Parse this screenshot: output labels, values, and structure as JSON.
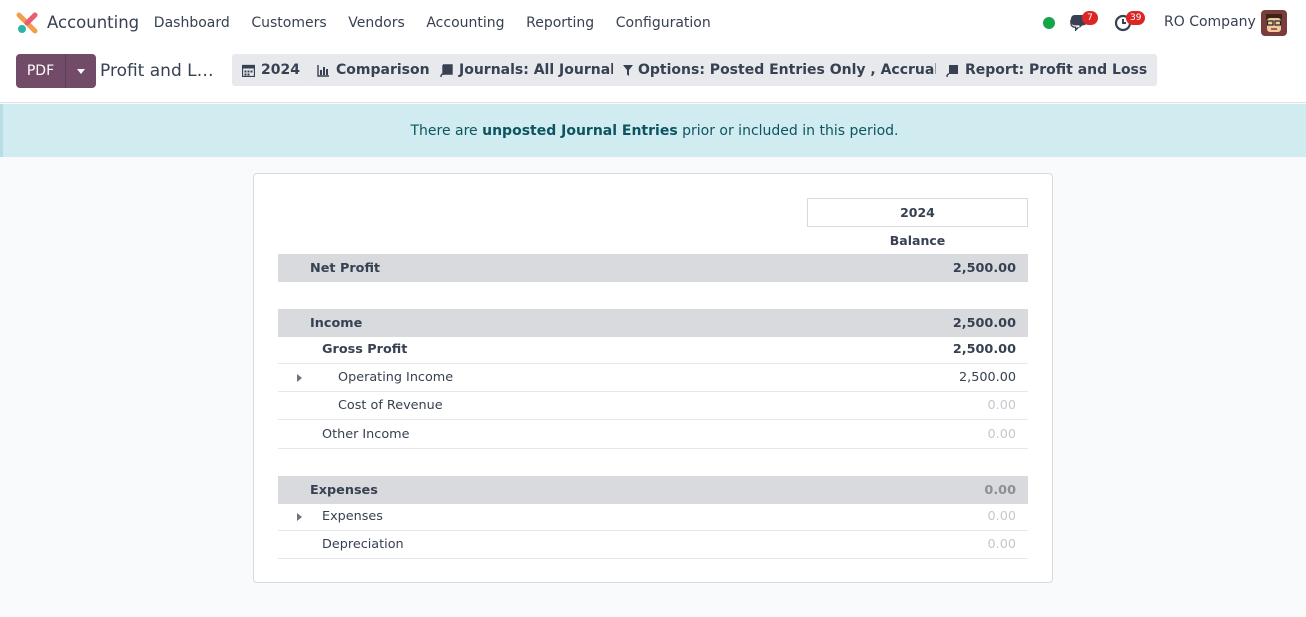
{
  "navbar": {
    "app_name": "Accounting",
    "menu": [
      "Dashboard",
      "Customers",
      "Vendors",
      "Accounting",
      "Reporting",
      "Configuration"
    ],
    "chat_count": "7",
    "activity_count": "39",
    "company": "RO Company"
  },
  "control": {
    "pdf_label": "PDF",
    "report_title": "Profit and L…",
    "filters": {
      "period": "2024",
      "comparison": "Comparison",
      "journals": "Journals: All Journals",
      "options": "Options: Posted Entries Only , Accrual Basis",
      "report": "Report: Profit and Loss"
    }
  },
  "alert": {
    "prefix": "There are ",
    "link": "unposted Journal Entries",
    "suffix": " prior or included in this period."
  },
  "report": {
    "column_period": "2024",
    "column_label": "Balance",
    "rows": [
      {
        "label": "Net Profit",
        "value": "2,500.00"
      },
      {
        "label": "Income",
        "value": "2,500.00"
      },
      {
        "label": "Gross Profit",
        "value": "2,500.00"
      },
      {
        "label": "Operating Income",
        "value": "2,500.00"
      },
      {
        "label": "Cost of Revenue",
        "value": "0.00"
      },
      {
        "label": "Other Income",
        "value": "0.00"
      },
      {
        "label": "Expenses",
        "value": "0.00"
      },
      {
        "label": "Expenses",
        "value": "0.00"
      },
      {
        "label": "Depreciation",
        "value": "0.00"
      }
    ]
  },
  "colors": {
    "brand": "#714b67",
    "alert_bg": "#d1ecf1",
    "total_row_bg": "#d8dadd",
    "presence": "#16a34a",
    "badge": "#dc2626"
  },
  "icons": [
    "calendar-icon",
    "bar-chart-icon",
    "book-icon",
    "filter-icon",
    "chat-icon",
    "activity-clock-icon"
  ]
}
